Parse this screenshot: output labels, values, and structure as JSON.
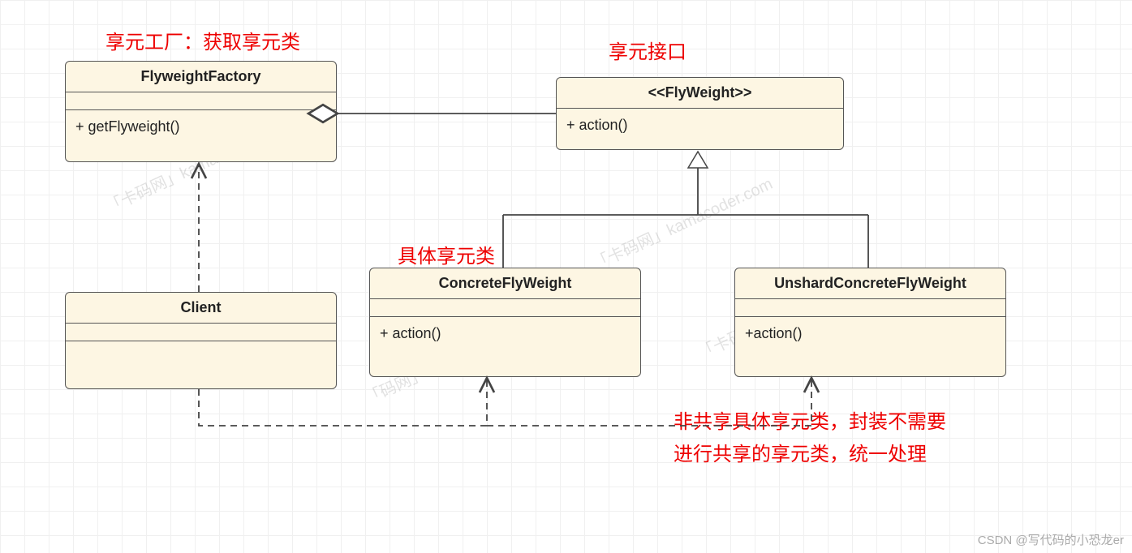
{
  "labels": {
    "factory": "享元工厂：获取享元类",
    "interface": "享元接口",
    "concrete": "具体享元类",
    "unshared_line1": "非共享具体享元类，封装不需要",
    "unshared_line2": "进行共享的享元类，统一处理"
  },
  "boxes": {
    "factory": {
      "title": "FlyweightFactory",
      "method": "+ getFlyweight()"
    },
    "flyweight": {
      "title": "<<FlyWeight>>",
      "method": "+ action()"
    },
    "client": {
      "title": "Client",
      "method": " "
    },
    "concrete": {
      "title": "ConcreteFlyWeight",
      "method": "+ action()"
    },
    "unshared": {
      "title": "UnshardConcreteFlyWeight",
      "method": "+action()"
    }
  },
  "watermarks": {
    "w1": "「卡码网」kamacoder.com",
    "w2": "「码网」kamacoder.com",
    "w3": "「卡码网」kamacoder.com",
    "w4": "「卡码网」kamacoder.com"
  },
  "credit": "CSDN @写代码的小恐龙er"
}
